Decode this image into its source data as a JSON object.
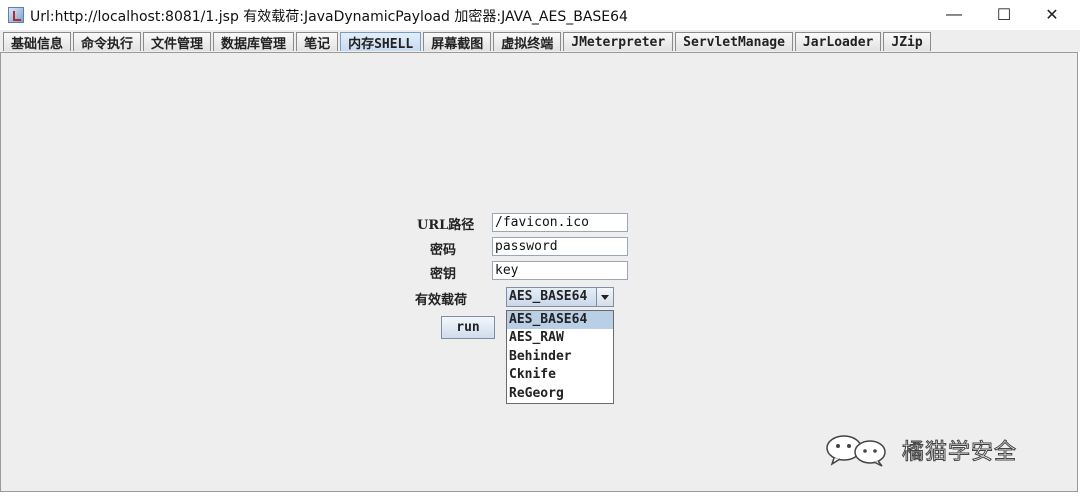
{
  "window": {
    "title": "Url:http://localhost:8081/1.jsp 有效载荷:JavaDynamicPayload 加密器:JAVA_AES_BASE64",
    "minimize": "—",
    "maximize": "☐",
    "close": "✕"
  },
  "tabs": [
    {
      "label": "基础信息",
      "active": false
    },
    {
      "label": "命令执行",
      "active": false
    },
    {
      "label": "文件管理",
      "active": false
    },
    {
      "label": "数据库管理",
      "active": false
    },
    {
      "label": "笔记",
      "active": false
    },
    {
      "label": "内存SHELL",
      "active": true
    },
    {
      "label": "屏幕截图",
      "active": false
    },
    {
      "label": "虚拟终端",
      "active": false
    },
    {
      "label": "JMeterpreter",
      "active": false
    },
    {
      "label": "ServletManage",
      "active": false
    },
    {
      "label": "JarLoader",
      "active": false
    },
    {
      "label": "JZip",
      "active": false
    }
  ],
  "form": {
    "url_label": "URL路径",
    "url_value": "/favicon.ico",
    "password_label": "密码",
    "password_value": "password",
    "key_label": "密钥",
    "key_value": "key",
    "payload_label": "有效载荷",
    "payload_selected": "AES_BASE64",
    "payload_options": [
      "AES_BASE64",
      "AES_RAW",
      "Behinder",
      "Cknife",
      "ReGeorg"
    ],
    "run_label": "run"
  },
  "watermark": {
    "text": "橘猫学安全"
  }
}
